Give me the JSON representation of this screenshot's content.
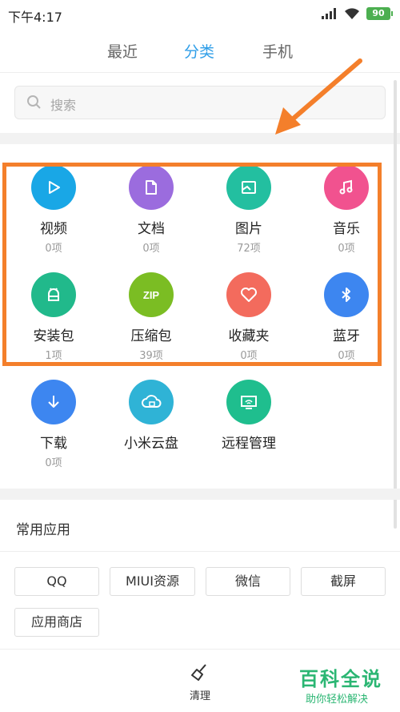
{
  "status_bar": {
    "time": "下午4:17",
    "battery": "90"
  },
  "tabs": [
    "最近",
    "分类",
    "手机"
  ],
  "active_tab": "分类",
  "search": {
    "placeholder": "搜索"
  },
  "categories": [
    {
      "label": "视频",
      "count": "0项",
      "icon": "play-icon",
      "color": "#19a7e6"
    },
    {
      "label": "文档",
      "count": "0项",
      "icon": "document-icon",
      "color": "#9b6cde"
    },
    {
      "label": "图片",
      "count": "72项",
      "icon": "image-icon",
      "color": "#23bfa0"
    },
    {
      "label": "音乐",
      "count": "0项",
      "icon": "music-icon",
      "color": "#f1528f"
    },
    {
      "label": "安装包",
      "count": "1项",
      "icon": "android-icon",
      "color": "#21b98b"
    },
    {
      "label": "压缩包",
      "count": "39项",
      "icon": "zip-icon",
      "color": "#7bbd23"
    },
    {
      "label": "收藏夹",
      "count": "0项",
      "icon": "heart-icon",
      "color": "#f36b5d"
    },
    {
      "label": "蓝牙",
      "count": "0项",
      "icon": "bluetooth-icon",
      "color": "#3d86f0"
    },
    {
      "label": "下载",
      "count": "0项",
      "icon": "download-icon",
      "color": "#3d86f0"
    },
    {
      "label": "小米云盘",
      "count": "",
      "icon": "cloud-icon",
      "color": "#2fb3d6"
    },
    {
      "label": "远程管理",
      "count": "",
      "icon": "remote-icon",
      "color": "#1fbe8e"
    }
  ],
  "zip_text": "ZIP",
  "common_apps": {
    "title": "常用应用",
    "apps": [
      "QQ",
      "MIUI资源",
      "微信",
      "截屏",
      "应用商店"
    ]
  },
  "bottom": {
    "clean_label": "清理"
  },
  "watermark": {
    "title": "百科全说",
    "subtitle": "助你轻松解决"
  },
  "colors": {
    "accent": "#2f9ee8",
    "highlight": "#f47f2b",
    "watermark": "#2bb673"
  }
}
